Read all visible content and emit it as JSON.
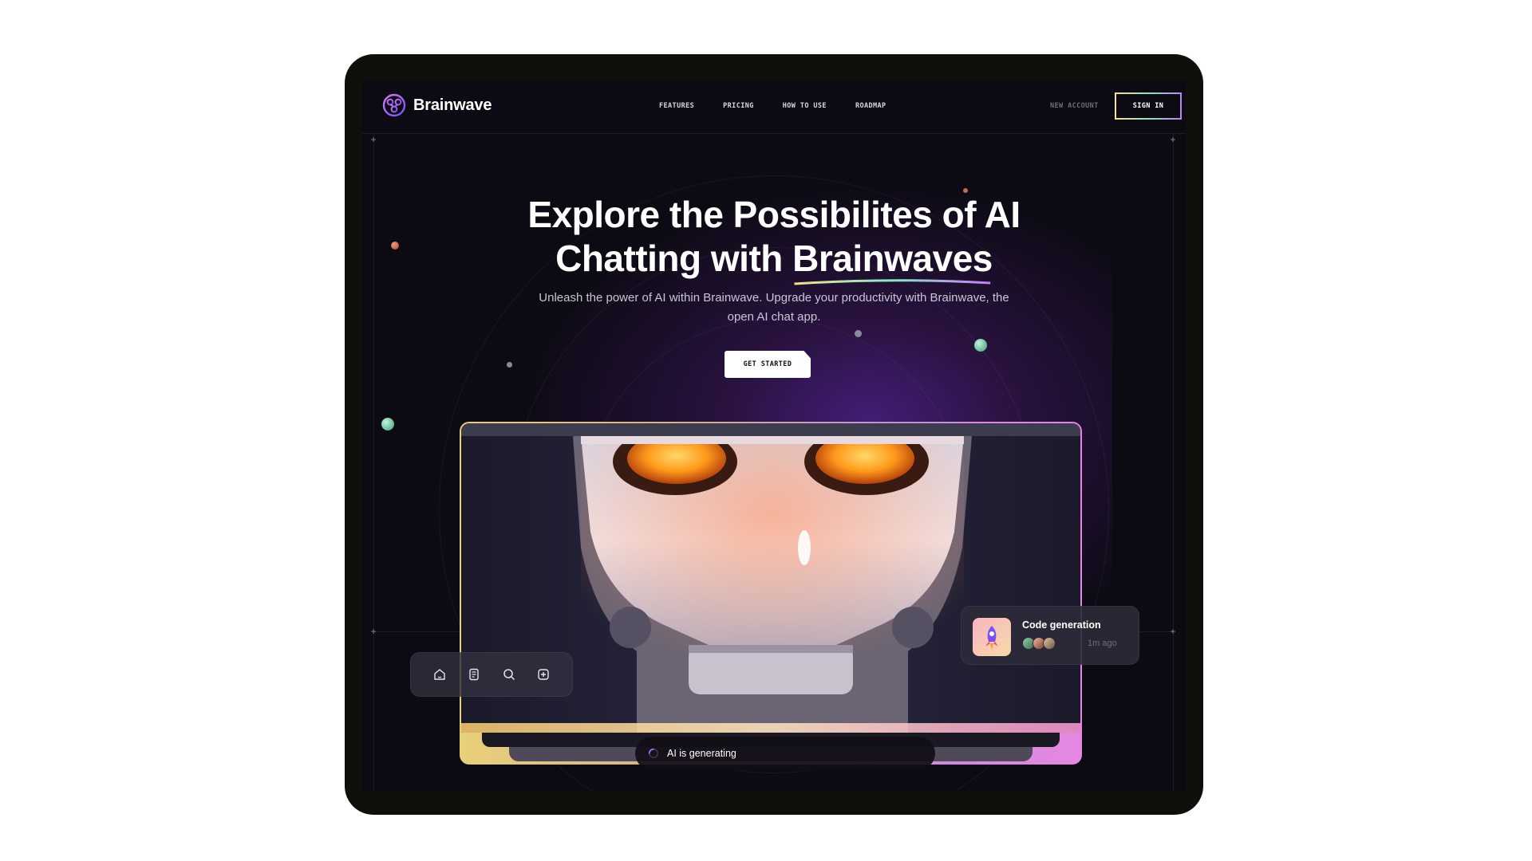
{
  "app": {
    "brand": "Brainwave",
    "colors": {
      "accent": "#ac6aff",
      "background": "#0c0a12",
      "cta": "#ffffff"
    }
  },
  "nav": {
    "links": [
      {
        "label": "FEATURES"
      },
      {
        "label": "PRICING"
      },
      {
        "label": "HOW TO USE"
      },
      {
        "label": "ROADMAP"
      }
    ],
    "new_account": "NEW ACCOUNT",
    "sign_in": "SIGN IN"
  },
  "hero": {
    "title_line1": "Explore the Possibilites of AI",
    "title_line2_prefix": "Chatting with ",
    "title_highlight": "Brainwaves",
    "subtitle": "Unleash the power of AI within Brainwave. Upgrade your productivity with Brainwave, the open AI chat app.",
    "cta": "GET STARTED"
  },
  "showcase": {
    "toolbar_icons": [
      "home-icon",
      "file-icon",
      "search-icon",
      "plus-square-icon"
    ],
    "notification": {
      "title": "Code generation",
      "time": "1m ago",
      "thumb_icon": "rocket-icon"
    },
    "status": "AI is generating"
  }
}
